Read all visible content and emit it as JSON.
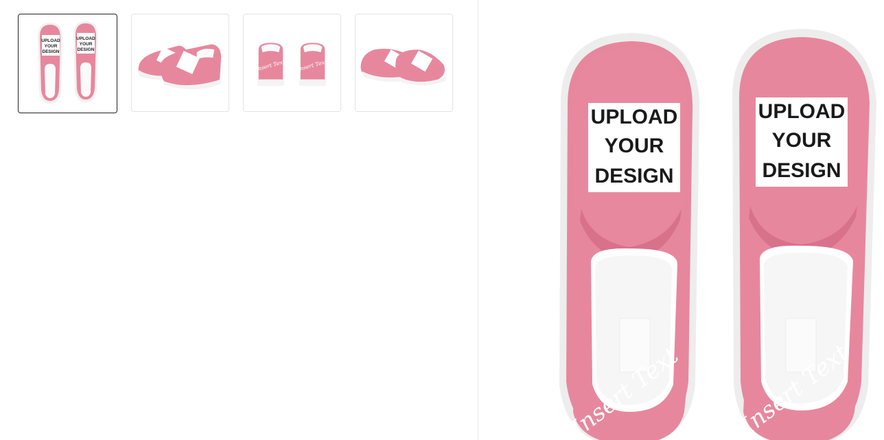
{
  "product_gallery": {
    "thumbnails": [
      {
        "view": "top view",
        "selected": true
      },
      {
        "view": "side view",
        "selected": false
      },
      {
        "view": "back view",
        "selected": false
      },
      {
        "view": "other side view",
        "selected": false
      }
    ],
    "main_image": {
      "view": "top view"
    }
  },
  "design_placeholder": {
    "line1": "UPLOAD",
    "line2": "YOUR",
    "line3": "DESIGN"
  },
  "heel_text": "Insert Text",
  "colors": {
    "shoe_pink": "#E7879D",
    "shoe_pink_dark": "#D8728A",
    "sole_white": "#F4F4F4",
    "selected_border": "#222222"
  }
}
